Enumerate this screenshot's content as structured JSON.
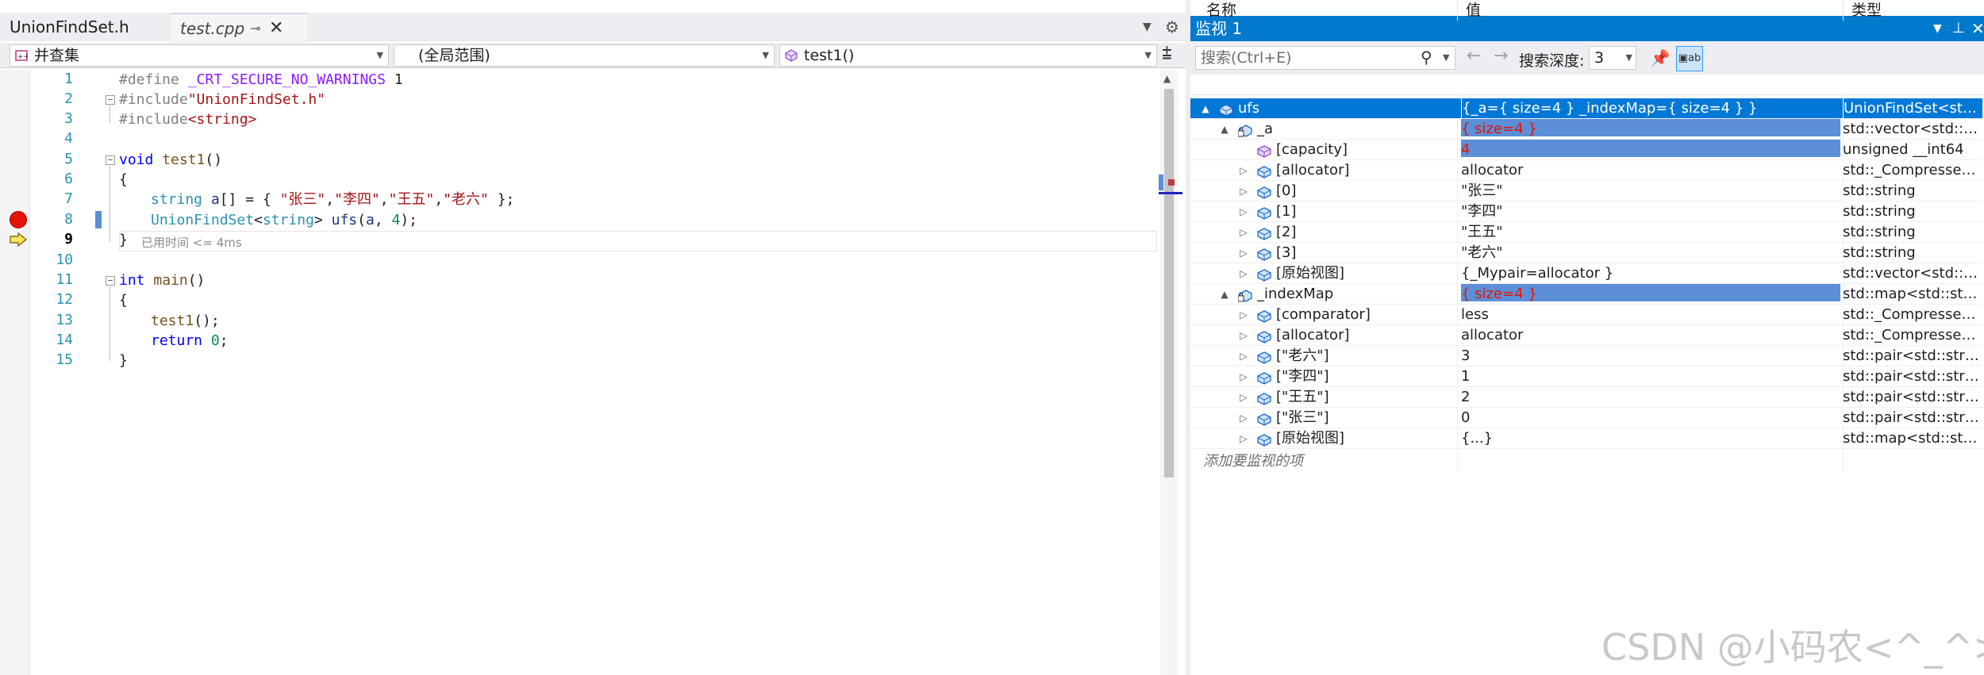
{
  "editor": {
    "tabs": [
      {
        "label": "UnionFindSet.h",
        "active": false
      },
      {
        "label": "test.cpp",
        "active": true,
        "pinned_icon": "pin-icon",
        "close_icon": "close-icon"
      }
    ],
    "nav": {
      "project": "并查集",
      "scope": "(全局范围)",
      "function": "test1()"
    },
    "line_numbers": [
      "1",
      "2",
      "3",
      "4",
      "5",
      "6",
      "7",
      "8",
      "9",
      "10",
      "11",
      "12",
      "13",
      "14",
      "15"
    ],
    "current_line": "9",
    "code": {
      "l1": {
        "pp": "#define ",
        "macro": "_CRT_SECURE_NO_WARNINGS",
        "rest": " 1"
      },
      "l2": {
        "pp": "#include",
        "str": "\"UnionFindSet.h\""
      },
      "l3": {
        "pp": "#include",
        "str": "<string>"
      },
      "l5": {
        "kw": "void",
        "fn": " test1",
        "rest": "()"
      },
      "l6": "{",
      "l7": {
        "ty": "string",
        "var": " a",
        "p1": "[] = { ",
        "s1": "\"张三\"",
        "c1": ",",
        "s2": "\"李四\"",
        "c2": ",",
        "s3": "\"王五\"",
        "c3": ",",
        "s4": "\"老六\"",
        "end": " };"
      },
      "l8": {
        "ty": "UnionFindSet",
        "p1": "<",
        "ty2": "string",
        "p2": ">",
        "var": " ufs",
        "p3": "(",
        "var2": "a",
        "p4": ", ",
        "num": "4",
        "p5": ");"
      },
      "l9": "}",
      "elapsed": "已用时间 <= 4ms",
      "l11": {
        "kw": "int",
        "fn": " main",
        "rest": "()"
      },
      "l12": "{",
      "l13": {
        "fn": "test1",
        "rest": "();"
      },
      "l14": {
        "kw": "return",
        "num": " 0",
        "rest": ";"
      },
      "l15": "}"
    }
  },
  "watch": {
    "title": "监视 1",
    "search_placeholder": "搜索(Ctrl+E)",
    "depth_label": "搜索深度:",
    "depth_value": "3",
    "columns": {
      "name": "名称",
      "value": "值",
      "type": "类型"
    },
    "rows": [
      {
        "name": "ufs",
        "value": "{_a={ size=4 } _indexMap={ size=4 } }",
        "type": "UnionFindSet<std...",
        "level": 0,
        "expander": "▲",
        "selected": true,
        "changed": false,
        "icon": "object-icon"
      },
      {
        "name": "_a",
        "value": "{ size=4 }",
        "type": "std::vector<std::st...",
        "level": 1,
        "expander": "▲",
        "changed": true,
        "icon": "private-field-icon"
      },
      {
        "name": "[capacity]",
        "value": "4",
        "type": "unsigned __int64",
        "level": 2,
        "expander": "",
        "changed": true,
        "icon": "property-icon"
      },
      {
        "name": "[allocator]",
        "value": "allocator",
        "type": "std::_Compressed...",
        "level": 2,
        "expander": "▷",
        "changed": false,
        "icon": "field-icon"
      },
      {
        "name": "[0]",
        "value": "\"张三\"",
        "type": "std::string",
        "level": 2,
        "expander": "▷",
        "changed": false,
        "icon": "field-icon"
      },
      {
        "name": "[1]",
        "value": "\"李四\"",
        "type": "std::string",
        "level": 2,
        "expander": "▷",
        "changed": false,
        "icon": "field-icon"
      },
      {
        "name": "[2]",
        "value": "\"王五\"",
        "type": "std::string",
        "level": 2,
        "expander": "▷",
        "changed": false,
        "icon": "field-icon"
      },
      {
        "name": "[3]",
        "value": "\"老六\"",
        "type": "std::string",
        "level": 2,
        "expander": "▷",
        "changed": false,
        "icon": "field-icon"
      },
      {
        "name": "[原始视图]",
        "value": "{_Mypair=allocator }",
        "type": "std::vector<std::st...",
        "level": 2,
        "expander": "▷",
        "changed": false,
        "icon": "field-icon"
      },
      {
        "name": "_indexMap",
        "value": "{ size=4 }",
        "type": "std::map<std::stri...",
        "level": 1,
        "expander": "▲",
        "changed": true,
        "icon": "private-field-icon"
      },
      {
        "name": "[comparator]",
        "value": "less",
        "type": "std::_Compressed...",
        "level": 2,
        "expander": "▷",
        "changed": false,
        "icon": "field-icon"
      },
      {
        "name": "[allocator]",
        "value": "allocator",
        "type": "std::_Compressed...",
        "level": 2,
        "expander": "▷",
        "changed": false,
        "icon": "field-icon"
      },
      {
        "name": "[\"老六\"]",
        "value": "3",
        "type": "std::pair<std::strin...",
        "level": 2,
        "expander": "▷",
        "changed": false,
        "icon": "field-icon"
      },
      {
        "name": "[\"李四\"]",
        "value": "1",
        "type": "std::pair<std::strin...",
        "level": 2,
        "expander": "▷",
        "changed": false,
        "icon": "field-icon"
      },
      {
        "name": "[\"王五\"]",
        "value": "2",
        "type": "std::pair<std::strin...",
        "level": 2,
        "expander": "▷",
        "changed": false,
        "icon": "field-icon"
      },
      {
        "name": "[\"张三\"]",
        "value": "0",
        "type": "std::pair<std::strin...",
        "level": 2,
        "expander": "▷",
        "changed": false,
        "icon": "field-icon"
      },
      {
        "name": "[原始视图]",
        "value": "{...}",
        "type": "std::map<std::stri...",
        "level": 2,
        "expander": "▷",
        "changed": false,
        "icon": "field-icon"
      }
    ],
    "add_item": "添加要监视的项"
  },
  "watermark": "CSDN @小码农<^_^>",
  "colors": {
    "accent": "#007acc",
    "selection": "#0078d7",
    "changed_value": "#e51400",
    "breakpoint": "#e51400"
  }
}
